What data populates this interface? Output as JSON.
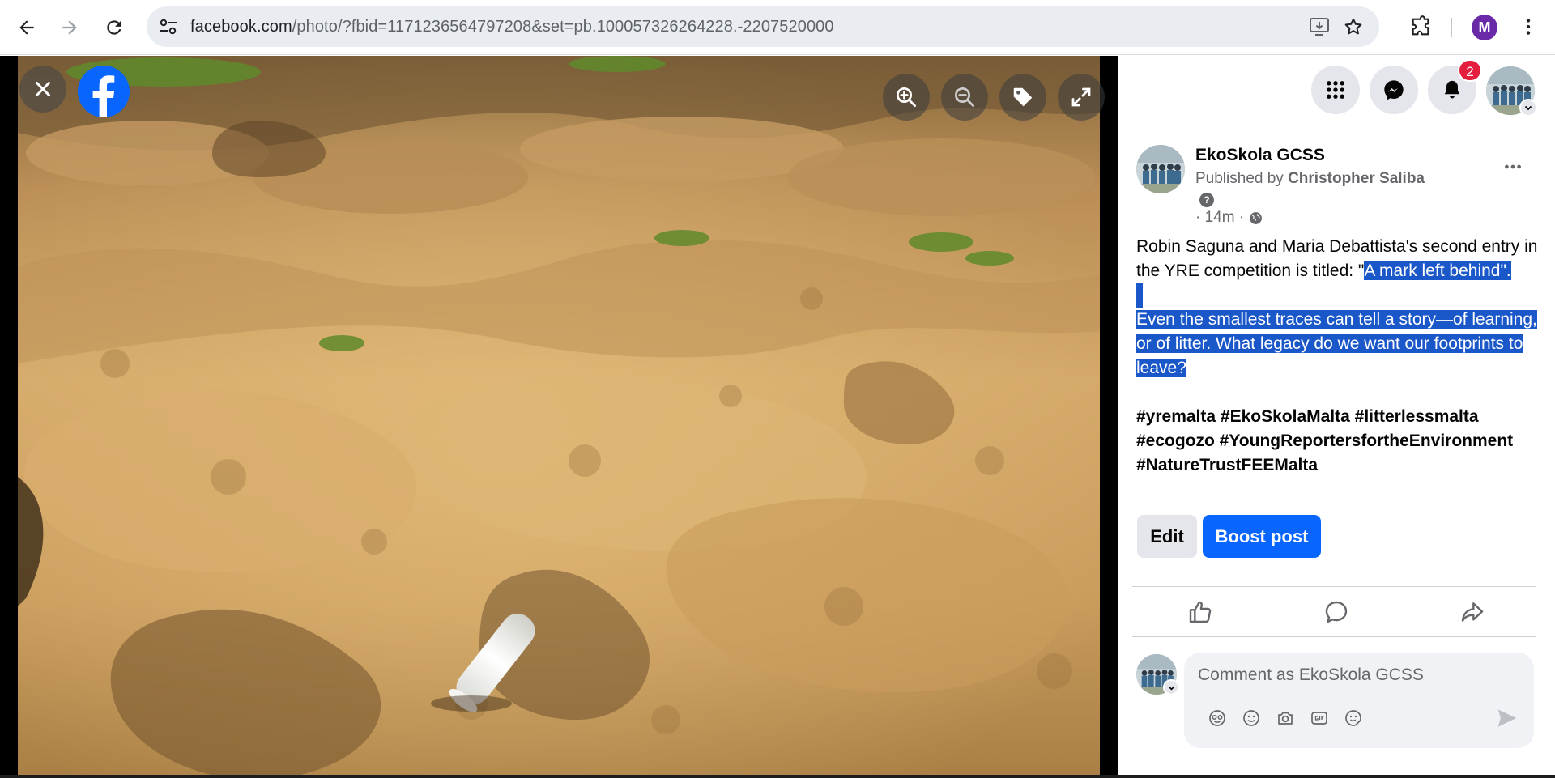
{
  "browser": {
    "url_host": "facebook.com",
    "url_rest": "/photo/?fbid=1171236564797208&set=pb.100057326264228.-2207520000",
    "profile_initial": "M"
  },
  "viewer": {
    "icons": [
      "close-icon",
      "facebook-logo",
      "zoom-in-icon",
      "zoom-out-icon",
      "tag-icon",
      "fullscreen-icon"
    ]
  },
  "top_nav": {
    "notification_count": "2"
  },
  "post": {
    "author": "EkoSkola GCSS",
    "published_prefix": "Published by",
    "publisher": "Christopher Saliba",
    "help_glyph": "?",
    "time": "· 14m ·",
    "text_intro": "Robin Saguna and Maria Debattista's second entry in the YRE competition is titled: \"",
    "text_title": "A mark left behind\".",
    "text_body": "Even the smallest traces can tell a story—of learning, or of litter. What legacy do we want our footprints to leave?",
    "hashtags": "#yremalta #EkoSkolaMalta #litterlessmalta #ecogozo #YoungReportersfortheEnvironment #NatureTrustFEEMalta",
    "edit_label": "Edit",
    "boost_label": "Boost post"
  },
  "comment": {
    "placeholder": "Comment as EkoSkola GCSS"
  },
  "colors": {
    "facebook_blue": "#0866ff",
    "selection": "#1a57c9",
    "badge_red": "#e41e3f"
  }
}
